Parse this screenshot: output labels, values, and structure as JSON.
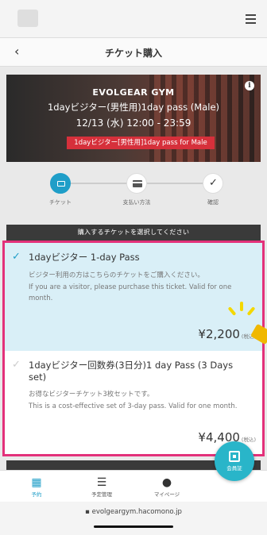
{
  "header": {
    "menu_icon": "hamburger-icon"
  },
  "titlebar": {
    "back_icon": "chevron-left-icon",
    "title": "チケット購入"
  },
  "banner": {
    "gym_name": "EVOLGEAR GYM",
    "pass_name": "1dayビジター(男性用)1day pass (Male)",
    "date_time": "12/13 (水) 12:00 - 23:59",
    "tag": "1dayビジター[男性用]1day pass for Male",
    "info_icon": "i"
  },
  "steps": [
    {
      "label": "チケット",
      "icon": "ticket-icon",
      "active": true
    },
    {
      "label": "支払い方法",
      "icon": "payment-card-icon",
      "active": false
    },
    {
      "label": "確認",
      "icon": "check-icon",
      "active": false
    }
  ],
  "select_prompt": "購入するチケットを選択してください",
  "tickets": [
    {
      "name": "1dayビジター 1-day Pass",
      "desc_jp": "ビジター利用の方はこちらのチケットをご購入ください。",
      "desc_en": "If you are a visitor, please purchase this ticket. Valid for one month.",
      "price": "¥2,200",
      "tax": "(税込)",
      "selected": true
    },
    {
      "name": "1dayビジター回数券(3日分)1 day Pass (3 Days set)",
      "desc_jp": "お得なビジターチケット3枚セットです。",
      "desc_en": "This is a cost-effective set of 3-day pass. Valid for one month.",
      "price": "¥4,400",
      "tax": "(税込)",
      "selected": false
    }
  ],
  "bottom_nav": [
    {
      "label": "予約",
      "icon": "calendar-icon",
      "active": true
    },
    {
      "label": "予定管理",
      "icon": "list-icon",
      "active": false
    },
    {
      "label": "マイページ",
      "icon": "user-icon",
      "active": false
    }
  ],
  "member_button": {
    "label": "会員証",
    "icon": "qr-code-icon"
  },
  "browser": {
    "url": "evolgeargym.hacomono.jp",
    "lock_icon": "lock-icon"
  },
  "colors": {
    "accent": "#1f9ec8",
    "highlight_border": "#e3317a",
    "tag_red": "#d6303b",
    "selected_bg": "#d9eff7"
  }
}
